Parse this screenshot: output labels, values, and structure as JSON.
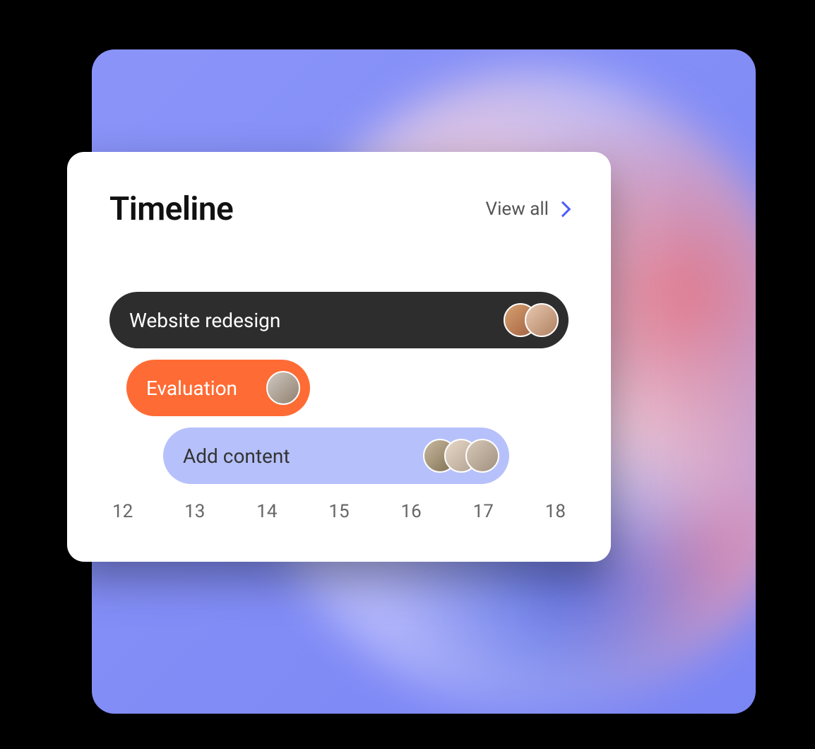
{
  "card": {
    "title": "Timeline",
    "view_all_label": "View all"
  },
  "bars": [
    {
      "label": "Website redesign",
      "color": "#2e2d2d",
      "avatar_count": 2
    },
    {
      "label": "Evaluation",
      "color": "#ff6b35",
      "avatar_count": 1
    },
    {
      "label": "Add content",
      "color": "#b6c1fb",
      "avatar_count": 3
    }
  ],
  "axis": [
    "12",
    "13",
    "14",
    "15",
    "16",
    "17",
    "18"
  ],
  "chart_data": {
    "type": "gantt",
    "title": "Timeline",
    "x_axis": [
      12,
      13,
      14,
      15,
      16,
      17,
      18
    ],
    "tasks": [
      {
        "name": "Website redesign",
        "start": 12,
        "end": 18,
        "assignees": 2
      },
      {
        "name": "Evaluation",
        "start": 12.2,
        "end": 14.6,
        "assignees": 1
      },
      {
        "name": "Add content",
        "start": 12.7,
        "end": 17.3,
        "assignees": 3
      }
    ]
  }
}
